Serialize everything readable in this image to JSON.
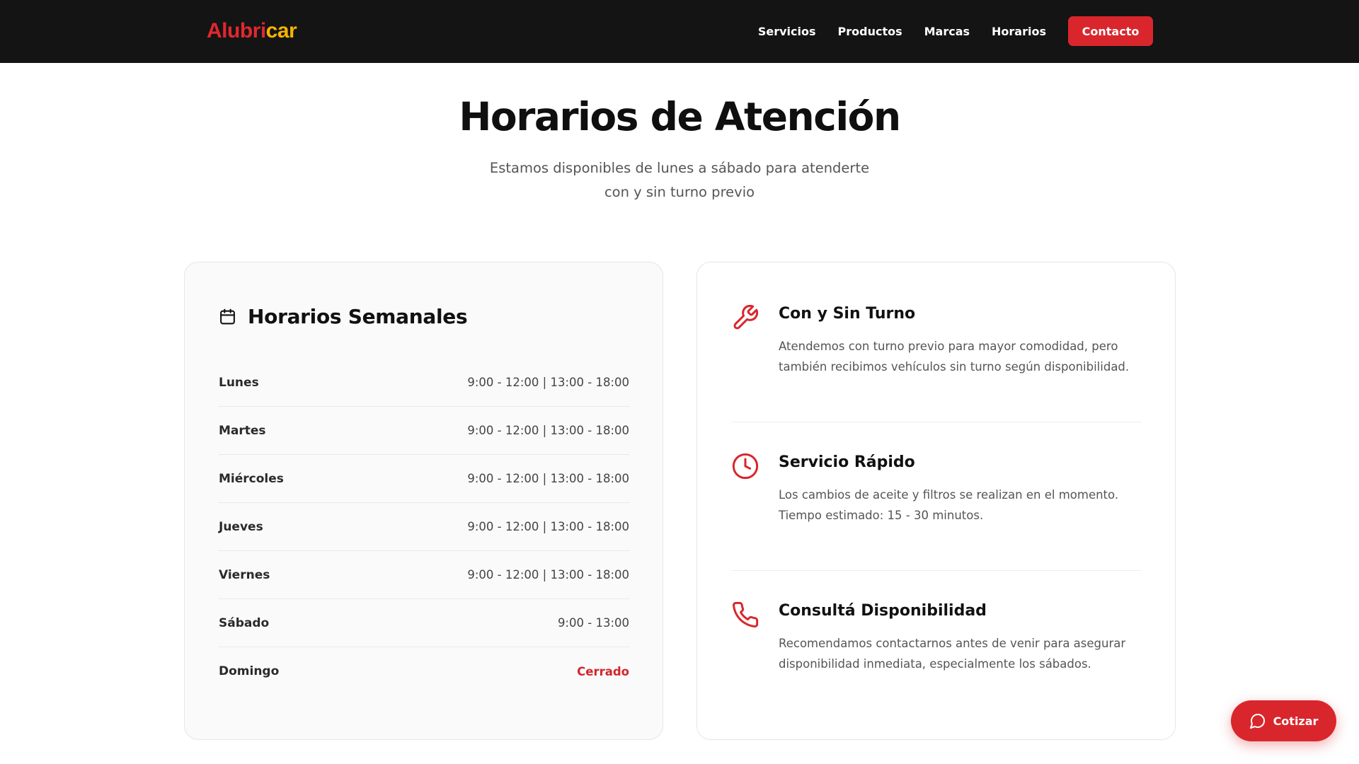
{
  "brand": {
    "part1": "Alubri",
    "part2": "car"
  },
  "nav": {
    "links": [
      "Servicios",
      "Productos",
      "Marcas",
      "Horarios"
    ],
    "cta": "Contacto"
  },
  "hero": {
    "title": "Horarios de Atención",
    "subtitle_line1": "Estamos disponibles de lunes a sábado para atenderte",
    "subtitle_line2": "con y sin turno previo"
  },
  "schedule": {
    "title": "Horarios Semanales",
    "rows": [
      {
        "day": "Lunes",
        "hours": "9:00 - 12:00 | 13:00 - 18:00"
      },
      {
        "day": "Martes",
        "hours": "9:00 - 12:00 | 13:00 - 18:00"
      },
      {
        "day": "Miércoles",
        "hours": "9:00 - 12:00 | 13:00 - 18:00"
      },
      {
        "day": "Jueves",
        "hours": "9:00 - 12:00 | 13:00 - 18:00"
      },
      {
        "day": "Viernes",
        "hours": "9:00 - 12:00 | 13:00 - 18:00"
      },
      {
        "day": "Sábado",
        "hours": "9:00 - 13:00"
      },
      {
        "day": "Domingo",
        "hours": "Cerrado"
      }
    ]
  },
  "features": [
    {
      "icon": "wrench-icon",
      "title": "Con y Sin Turno",
      "description": "Atendemos con turno previo para mayor comodidad, pero también recibimos vehículos sin turno según disponibilidad."
    },
    {
      "icon": "clock-icon",
      "title": "Servicio Rápido",
      "description": "Los cambios de aceite y filtros se realizan en el momento. Tiempo estimado: 15 - 30 minutos."
    },
    {
      "icon": "phone-icon",
      "title": "Consultá Disponibilidad",
      "description": "Recomendamos contactarnos antes de venir para asegurar disponibilidad inmediata, especialmente los sábados."
    }
  ],
  "float_button": {
    "label": "Cotizar",
    "icon": "chat-bubble-icon"
  },
  "colors": {
    "navbar_bg": "#141414",
    "accent_red": "#d9262c",
    "brand_yellow": "#f5b400",
    "closed_text": "#d1262c"
  }
}
